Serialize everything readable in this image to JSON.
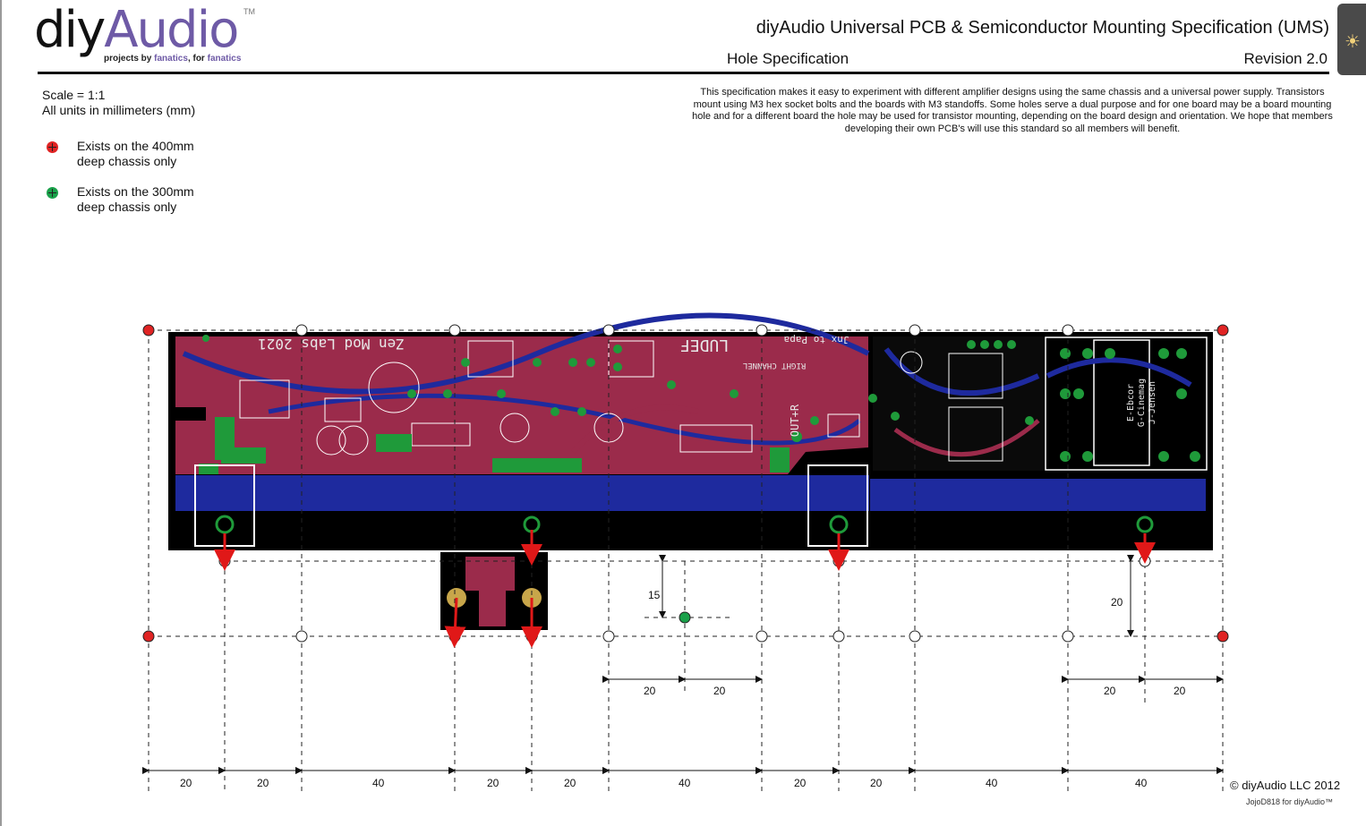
{
  "logo": {
    "part1": "diy",
    "part2": "Audio",
    "tm": "TM",
    "tag_a": "projects by ",
    "tag_b": "fanatics",
    "tag_c": ", for ",
    "tag_d": "fanatics"
  },
  "header": {
    "title": "diyAudio Universal PCB & Semiconductor Mounting Specification (UMS)",
    "subtitle": "Hole Specification",
    "revision": "Revision 2.0"
  },
  "scale": {
    "line1": "Scale = 1:1",
    "line2": "All units in millimeters (mm)"
  },
  "legend": [
    {
      "line1": "Exists on the 400mm",
      "line2": "deep chassis only",
      "color": "#e02424"
    },
    {
      "line1": "Exists on the 300mm",
      "line2": "deep chassis only",
      "color": "#1aa14a"
    }
  ],
  "description": "This specification makes it easy to experiment with different amplifier designs using the same chassis and a universal power supply. Transistors mount using M3 hex socket bolts and the boards with M3 standoffs. Some holes serve a dual purpose and for one board may be a board mounting hole and for a different board the hole may be used for transistor mounting, depending on the board design and orientation. We hope that members developing their own PCB's will use this standard so all members will benefit.",
  "pcb_text": {
    "brand": "Zen Mod Labs 2021",
    "ludef": "LUDEF",
    "channel": "RIGHT CHANNEL",
    "jnx": "Jnx to Papa",
    "out": "OUT+R",
    "tag1": "E-Ebcor",
    "tag2": "G-Cinemag",
    "tag3": "J-Jensen"
  },
  "dims": {
    "v15": "15",
    "v20": "20",
    "mid_a": "20",
    "mid_b": "20",
    "right_a": "20",
    "right_b": "20",
    "bottom": [
      "20",
      "20",
      "40",
      "20",
      "20",
      "40",
      "20",
      "20",
      "40",
      "40"
    ]
  },
  "footer": {
    "copyright": "© diyAudio LLC 2012",
    "credit": "JojoD818 for diyAudio™"
  },
  "colors": {
    "pcb_red": "#9b2b4b",
    "pcb_blue": "#1e2a9e",
    "pad_green": "#1f9a3a",
    "arrow": "#e01818",
    "hole_red": "#e02424",
    "hole_green": "#1aa14a"
  }
}
